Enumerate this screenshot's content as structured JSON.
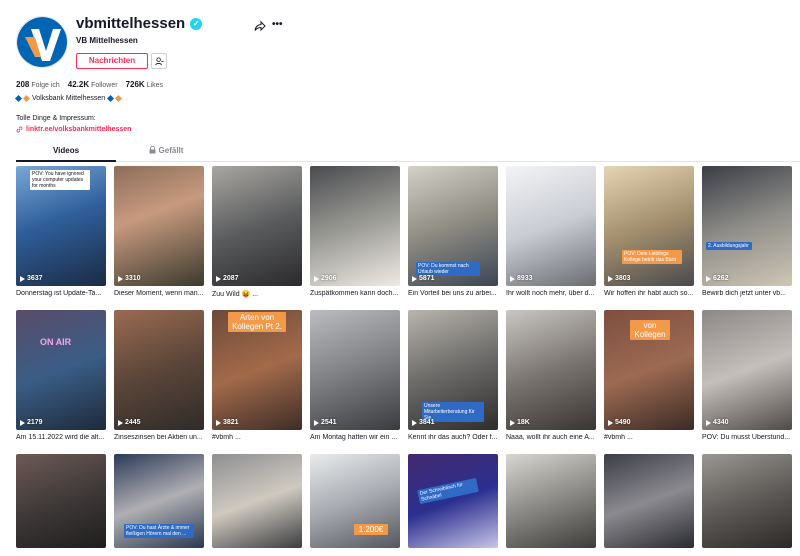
{
  "profile": {
    "username": "vbmittelhessen",
    "nickname": "VB Mittelhessen",
    "message_button": "Nachrichten",
    "stats": [
      {
        "value": "208",
        "label": "Folge ich"
      },
      {
        "value": "42.2K",
        "label": "Follower"
      },
      {
        "value": "726K",
        "label": "Likes"
      }
    ],
    "bio_line1": "Volksbank Mittelhessen",
    "bio_line2": "Tolle Dinge & Impressum:",
    "link": "linktr.ee/volksbankmittelhessen"
  },
  "tabs": {
    "videos": "Videos",
    "liked": "Gefällt"
  },
  "colors": {
    "accent": "#fe2c55",
    "verified": "#20d5ec",
    "brand_blue": "#0066b3",
    "brand_orange": "#f39a4a"
  },
  "videos": [
    {
      "views": "3637",
      "caption": "Donnerstag ist Update-Ta...",
      "overlay": "POV: You have ignored your computer updates for months"
    },
    {
      "views": "3310",
      "caption": "Dieser Moment, wenn man...",
      "overlay": ""
    },
    {
      "views": "2087",
      "caption": "Zuu Wild 😝 ...",
      "overlay": ""
    },
    {
      "views": "2906",
      "caption": "Zuspätkommen kann doch...",
      "overlay": ""
    },
    {
      "views": "5871",
      "caption": "Ein Vorteil bei uns zu arbei...",
      "overlay": "POV: Du kommst nach Urlaub wieder"
    },
    {
      "views": "8933",
      "caption": "Ihr wollt noch mehr, über d...",
      "overlay": ""
    },
    {
      "views": "3803",
      "caption": "Wir hoffen ihr habt auch so...",
      "overlay": "POV: Dein Lieblings Kollege betritt das Büro"
    },
    {
      "views": "6262",
      "caption": "Bewirb dich jetzt unter vb...",
      "overlay": "2. Ausbildungsjahr"
    },
    {
      "views": "2179",
      "caption": "Am 15.11.2022 wird die alt...",
      "overlay": "ON AIR"
    },
    {
      "views": "2445",
      "caption": "Zinseszinsen bei Aktien un...",
      "overlay": ""
    },
    {
      "views": "3821",
      "caption": "#vbmh ...",
      "overlay": "Arten von Kollegen Pt 2."
    },
    {
      "views": "2541",
      "caption": "Am Montag hatten wir ein ...",
      "overlay": ""
    },
    {
      "views": "3841",
      "caption": "Kennt ihr das auch? Oder f...",
      "overlay": "Unsere Mitarbeiterberatung für Sie"
    },
    {
      "views": "18K",
      "caption": "Naaa, wollt ihr auch eine A...",
      "overlay": ""
    },
    {
      "views": "5490",
      "caption": "#vbmh ...",
      "overlay": "von Kollegen"
    },
    {
      "views": "4340",
      "caption": "POV: Du musst Überstund...",
      "overlay": ""
    },
    {
      "views": "",
      "caption": "",
      "overlay": ""
    },
    {
      "views": "",
      "caption": "",
      "overlay": "POV: Du hast Ärzte & immer fleißigen Hörern mal den ..."
    },
    {
      "views": "",
      "caption": "",
      "overlay": ""
    },
    {
      "views": "",
      "caption": "",
      "overlay": "1.200€"
    },
    {
      "views": "",
      "caption": "",
      "overlay": "Der Schreibtisch für Schnäbel"
    },
    {
      "views": "",
      "caption": "",
      "overlay": ""
    },
    {
      "views": "",
      "caption": "",
      "overlay": ""
    },
    {
      "views": "",
      "caption": "",
      "overlay": ""
    }
  ]
}
